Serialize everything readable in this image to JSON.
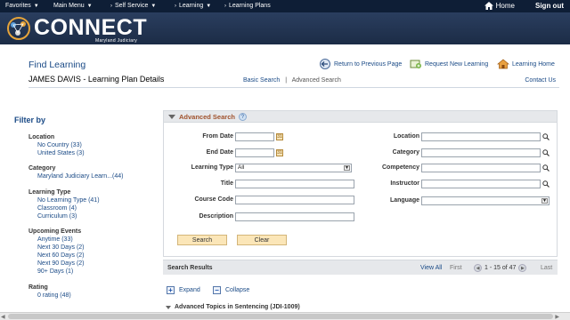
{
  "topnav": {
    "items": [
      {
        "label": "Favorites"
      },
      {
        "label": "Main Menu"
      },
      {
        "label": "Self Service"
      },
      {
        "label": "Learning"
      },
      {
        "label": "Learning Plans"
      }
    ],
    "home": "Home",
    "signout": "Sign out"
  },
  "brand": {
    "name": "CONNECT",
    "sub": "Maryland Judiciary",
    "color": "#1c2c46"
  },
  "header": {
    "title": "Find Learning",
    "return": "Return to Previous Page",
    "request": "Request New Learning",
    "learning_home": "Learning Home",
    "user_title": "JAMES DAVIS   - Learning Plan Details",
    "basic_search": "Basic Search",
    "separator": "|",
    "advanced_search": "Advanced Search",
    "contact": "Contact Us"
  },
  "filter": {
    "title": "Filter by",
    "groups": [
      {
        "heading": "Location",
        "items": [
          "No Country (33)",
          "United States (3)"
        ]
      },
      {
        "heading": "Category",
        "items": [
          "Maryland Judiciary Learn...(44)"
        ]
      },
      {
        "heading": "Learning Type",
        "items": [
          "No Learning Type (41)",
          "Classroom (4)",
          "Curriculum (3)"
        ]
      },
      {
        "heading": "Upcoming Events",
        "items": [
          "Anytime (33)",
          "Next 30 Days (2)",
          "Next 60 Days (2)",
          "Next 90 Days (2)",
          "90+ Days (1)"
        ]
      },
      {
        "heading": "Rating",
        "items": [
          "0 rating (48)"
        ]
      }
    ]
  },
  "advanced": {
    "title": "Advanced Search",
    "help": "?",
    "from_date": "From Date",
    "end_date": "End Date",
    "learning_type": "Learning Type",
    "learning_type_value": "All",
    "title_label": "Title",
    "course_code": "Course Code",
    "description": "Description",
    "location": "Location",
    "category": "Category",
    "competency": "Competency",
    "instructor": "Instructor",
    "language": "Language",
    "search_btn": "Search",
    "clear_btn": "Clear"
  },
  "results": {
    "title": "Search Results",
    "view_all": "View All",
    "first": "First",
    "range": "1 - 15 of 47",
    "last": "Last",
    "expand": "Expand",
    "collapse": "Collapse",
    "first_topic": "Advanced Topics in Sentencing (JDI-1009)"
  }
}
